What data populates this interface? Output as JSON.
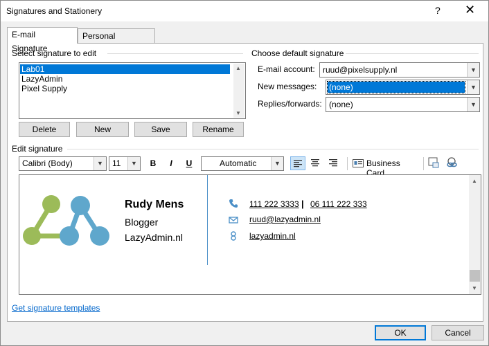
{
  "window": {
    "title": "Signatures and Stationery",
    "help": "?",
    "close": "✕"
  },
  "tabs": [
    {
      "label": "E-mail Signature",
      "active": true
    },
    {
      "label": "Personal Stationery",
      "active": false
    }
  ],
  "select_section": {
    "label": "Select signature to edit",
    "items": [
      "Lab01",
      "LazyAdmin",
      "Pixel Supply"
    ],
    "selected": "Lab01",
    "buttons": {
      "delete": "Delete",
      "new": "New",
      "save": "Save",
      "rename": "Rename"
    }
  },
  "default_section": {
    "label": "Choose default signature",
    "email_account_label": "E-mail account:",
    "email_account_value": "ruud@pixelsupply.nl",
    "new_messages_label": "New messages:",
    "new_messages_value": "(none)",
    "replies_label": "Replies/forwards:",
    "replies_value": "(none)"
  },
  "edit_section": {
    "label": "Edit signature",
    "font": "Calibri (Body)",
    "size": "11",
    "bold": "B",
    "italic": "I",
    "underline": "U",
    "color": "Automatic",
    "business_card": "Business Card"
  },
  "signature": {
    "name": "Rudy Mens",
    "role": "Blogger",
    "site": "LazyAdmin.nl",
    "phone1": "111 222 3333",
    "phone_sep": "|",
    "phone2": "06 111 222 333",
    "email": "ruud@lazyadmin.nl",
    "web": "lazyadmin.nl",
    "logo_colors": {
      "green": "#9cbb59",
      "blue": "#5fa7cc"
    }
  },
  "footer": {
    "templates_link": "Get signature templates",
    "ok": "OK",
    "cancel": "Cancel"
  }
}
